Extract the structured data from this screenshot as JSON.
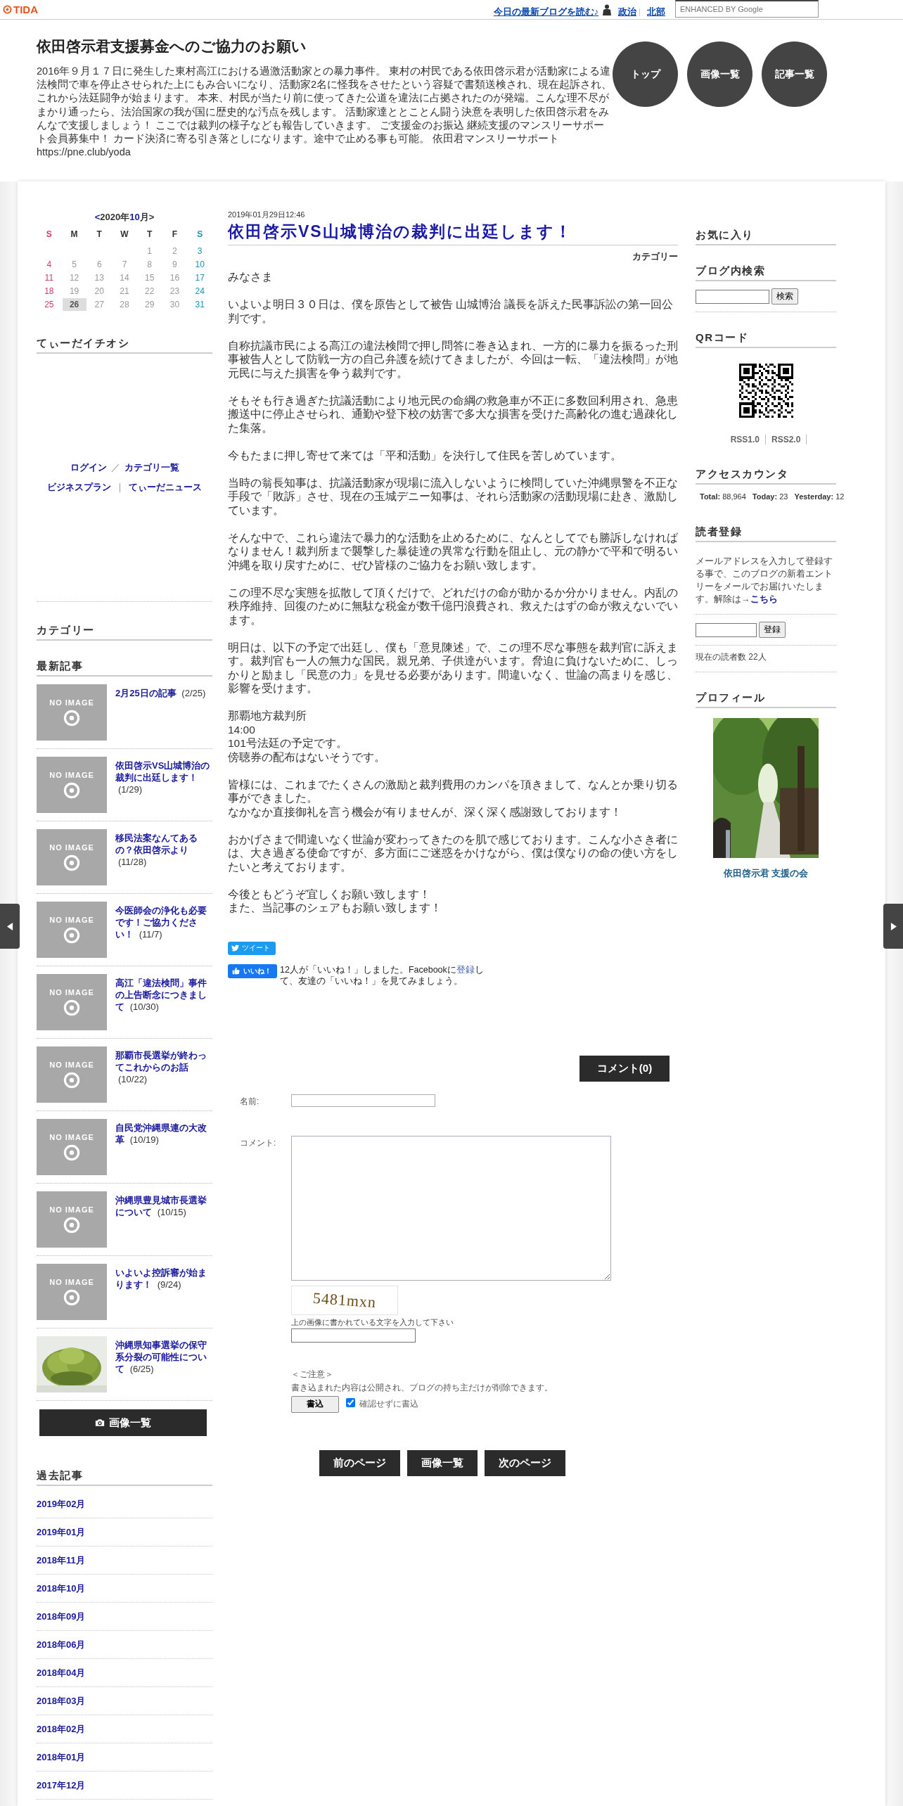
{
  "topbar": {
    "logo": "TIDA",
    "read_link": "今日の最新ブログを読む♪",
    "categories": [
      "政治",
      "北部"
    ],
    "search": {
      "placeholder": "ENHANCED BY Google"
    }
  },
  "header": {
    "title": "依田啓示君支援募金へのご協力のお願い",
    "description": "2016年９月１７日に発生した東村高江における過激活動家との暴力事件。 東村の村民である依田啓示君が活動家による違法検問で車を停止させられた上にもみ合いになり、活動家2名に怪我をさせたという容疑で書類送検され、現在起訴され、これから法廷闘争が始まります。 本来、村民が当たり前に使ってきた公道を違法に占拠されたのが発端。こんな理不尽がまかり通ったら、法治国家の我が国に歴史的な汚点を残します。 活動家達ととことん闘う決意を表明した依田啓示君をみんなで支援しましょう！ ここでは裁判の様子なども報告していきます。 ご支援金のお振込 継続支援のマンスリーサポート会員募集中！ カード決済に寄る引き落としになります。途中で止める事も可能。 依田君マンスリーサポート https://pne.club/yoda",
    "nav": [
      "トップ",
      "画像一覧",
      "記事一覧"
    ]
  },
  "calendar": {
    "prev": "<",
    "year": "2020年",
    "month": "10",
    "unit": "月",
    "next": ">",
    "weekdays": [
      "S",
      "M",
      "T",
      "W",
      "T",
      "F",
      "S"
    ],
    "weeks": [
      [
        {
          "day": "1",
          "today": false
        },
        {
          "day": "2",
          "today": false
        },
        {
          "day": "3",
          "today": false
        }
      ],
      [
        {
          "day": "4",
          "today": false
        },
        {
          "day": "5",
          "today": false
        },
        {
          "day": "6",
          "today": false
        },
        {
          "day": "7",
          "today": false
        },
        {
          "day": "8",
          "today": false
        },
        {
          "day": "9",
          "today": false
        },
        {
          "day": "10",
          "today": false
        }
      ],
      [
        {
          "day": "11",
          "today": false
        },
        {
          "day": "12",
          "today": false
        },
        {
          "day": "13",
          "today": false
        },
        {
          "day": "14",
          "today": false
        },
        {
          "day": "15",
          "today": false
        },
        {
          "day": "16",
          "today": false
        },
        {
          "day": "17",
          "today": false
        }
      ],
      [
        {
          "day": "18",
          "today": false
        },
        {
          "day": "19",
          "today": false
        },
        {
          "day": "20",
          "today": false
        },
        {
          "day": "21",
          "today": false
        },
        {
          "day": "22",
          "today": false
        },
        {
          "day": "23",
          "today": false
        },
        {
          "day": "24",
          "today": false
        }
      ],
      [
        {
          "day": "25",
          "today": false
        },
        {
          "day": "26",
          "today": true
        },
        {
          "day": "27",
          "today": false
        },
        {
          "day": "28",
          "today": false
        },
        {
          "day": "29",
          "today": false
        },
        {
          "day": "30",
          "today": false
        },
        {
          "day": "31",
          "today": false
        }
      ]
    ]
  },
  "pick": {
    "heading": "てぃーだイチオシ",
    "rows": [
      {
        "links": [
          "ログイン",
          "カテゴリ一覧"
        ],
        "separator": "／"
      },
      {
        "links": [
          "ビジネスプラン",
          "てぃーだニュース"
        ],
        "separator": "｜"
      }
    ]
  },
  "category": {
    "heading": "カテゴリー"
  },
  "recent": {
    "heading": "最新記事",
    "items": [
      {
        "title": "2月25日の記事",
        "date": "(2/25)",
        "kind": "no_image",
        "thumb_label": "NO IMAGE"
      },
      {
        "title": "依田啓示VS山城博治の裁判に出廷します！",
        "date": "(1/29)",
        "kind": "no_image",
        "thumb_label": "NO IMAGE"
      },
      {
        "title": "移民法案なんてあるの？依田啓示より",
        "date": "(11/28)",
        "kind": "no_image",
        "thumb_label": "NO IMAGE"
      },
      {
        "title": "今医師会の浄化も必要です！ご協力ください！",
        "date": "(11/7)",
        "kind": "no_image",
        "thumb_label": "NO IMAGE"
      },
      {
        "title": "高江「違法検問」事件の上告断念につきまして",
        "date": "(10/30)",
        "kind": "no_image",
        "thumb_label": "NO IMAGE"
      },
      {
        "title": "那覇市長選挙が終わってこれからのお話",
        "date": "(10/22)",
        "kind": "no_image",
        "thumb_label": "NO IMAGE"
      },
      {
        "title": "自民党沖縄県連の大改革",
        "date": "(10/19)",
        "kind": "no_image",
        "thumb_label": "NO IMAGE"
      },
      {
        "title": "沖縄県豊見城市長選挙について",
        "date": "(10/15)",
        "kind": "no_image",
        "thumb_label": "NO IMAGE"
      },
      {
        "title": "いよいよ控訴審が始まります！",
        "date": "(9/24)",
        "kind": "no_image",
        "thumb_label": "NO IMAGE"
      },
      {
        "title": "沖縄県知事選挙の保守系分裂の可能性について",
        "date": "(6/25)",
        "kind": "picture"
      }
    ],
    "gallery_button": "画像一覧"
  },
  "archive": {
    "heading": "過去記事",
    "months": [
      "2019年02月",
      "2019年01月",
      "2018年11月",
      "2018年10月",
      "2018年09月",
      "2018年06月",
      "2018年04月",
      "2018年03月",
      "2018年02月",
      "2018年01月",
      "2017年12月"
    ]
  },
  "article": {
    "date": "2019年01月29日12:46",
    "title": "依田啓示VS山城博治の裁判に出廷します！",
    "category_label": "カテゴリー",
    "paragraphs": [
      [
        "みなさま"
      ],
      [
        "いよいよ明日３０日は、僕を原告として被告 山城博治 議長を訴えた民事訴訟の第一回公判です。"
      ],
      [
        "自称抗議市民による高江の違法検問で押し問答に巻き込まれ、一方的に暴力を振るった刑事被告人として防戦一方の自己弁護を続けてきましたが、今回は一転、「違法検問」が地元民に与えた損害を争う裁判です。"
      ],
      [
        "そもそも行き過ぎた抗議活動により地元民の命綱の救急車が不正に多数回利用され、急患搬送中に停止させられ、通勤や登下校の妨害で多大な損害を受けた高齢化の進む過疎化した集落。"
      ],
      [
        "今もたまに押し寄せて来ては「平和活動」を決行して住民を苦しめています。"
      ],
      [
        "当時の翁長知事は、抗議活動家が現場に流入しないように検問していた沖縄県警を不正な手段で「敗訴」させ、現在の玉城デニー知事は、それら活動家の活動現場に赴き、激励しています。"
      ],
      [
        "そんな中で、これら違法で暴力的な活動を止めるために、なんとしてでも勝訴しなければなりません！裁判所まで襲撃した暴徒達の異常な行動を阻止し、元の静かで平和で明るい沖縄を取り戻すために、ぜひ皆様のご協力をお願い致します。"
      ],
      [
        "この理不尽な実態を拡散して頂くだけで、どれだけの命が助かるか分かりません。内乱の秩序維持、回復のために無駄な税金が数千億円浪費され、救えたはずの命が救えないでいます。"
      ],
      [
        "明日は、以下の予定で出廷し、僕も「意見陳述」で、この理不尽な事態を裁判官に訴えます。裁判官も一人の無力な国民。親兄弟、子供達がいます。脅迫に負けないために、しっかりと励まし「民意の力」を見せる必要があります。間違いなく、世論の高まりを感じ、影響を受けます。"
      ],
      [
        "那覇地方裁判所",
        "14:00",
        "101号法廷の予定です。",
        "傍聴券の配布はないそうです。"
      ],
      [
        "皆様には、これまでたくさんの激励と裁判費用のカンパを頂きまして、なんとか乗り切る事ができました。",
        "なかなか直接御礼を言う機会が有りませんが、深く深く感謝致しております！"
      ],
      [
        "おかげさまで間違いなく世論が変わってきたのを肌で感じております。こんな小さき者には、大き過ぎる使命ですが、多方面にご迷惑をかけながら、僕は僕なりの命の使い方をしたいと考えております。"
      ],
      [
        "今後ともどうぞ宜しくお願い致します！",
        "また、当記事のシェアもお願い致します！"
      ]
    ]
  },
  "social": {
    "tweet": "ツイート",
    "like": "いいね！",
    "like_text_before": "12人が「いいね！」しました。Facebookに",
    "like_link": "登録",
    "like_text_after": "して、友達の「いいね！」を見てみましょう。"
  },
  "comments": {
    "button": "コメント(0)",
    "name_label": "名前:",
    "comment_label": "コメント:",
    "captcha": "5481mxn",
    "captcha_hint": "上の画像に書かれている文字を入力して下さい",
    "notice_title": "＜ご注意＞",
    "notice": "書き込まれた内容は公開され、ブログの持ち主だけが削除できます。",
    "submit": "書込",
    "skip_confirm": {
      "label": "確認せずに書込",
      "checked": true
    }
  },
  "pager": [
    "前のページ",
    "画像一覧",
    "次のページ"
  ],
  "right": {
    "favorites": "お気に入り",
    "search_heading": "ブログ内検索",
    "search_button": "検索",
    "qr_heading": "QRコード",
    "rss": [
      "RSS1.0",
      "RSS2.0"
    ],
    "counter_heading": "アクセスカウンタ",
    "counter": [
      {
        "label": "Total:",
        "value": "88,964"
      },
      {
        "label": "Today:",
        "value": "23"
      },
      {
        "label": "Yesterday:",
        "value": "12"
      }
    ],
    "readers_heading": "読者登録",
    "readers_text": "メールアドレスを入力して登録する事で、このブログの新着エントリーをメールでお届けいたします。解除は→",
    "readers_link": "こちら",
    "readers_button": "登録",
    "readers_count": "現在の読者数 22人",
    "profile_heading": "プロフィール",
    "profile_name": "依田啓示君 支援の会"
  }
}
